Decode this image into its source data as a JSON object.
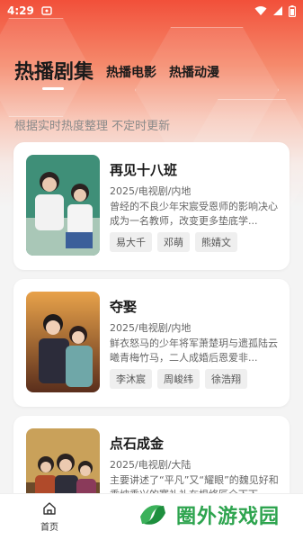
{
  "status_bar": {
    "time": "4:29"
  },
  "tabs": [
    {
      "label": "热播剧集",
      "active": true
    },
    {
      "label": "热播电影",
      "active": false
    },
    {
      "label": "热播动漫",
      "active": false
    }
  ],
  "subtitle": "根据实时热度整理 不定时更新",
  "cards": [
    {
      "title": "再见十八班",
      "meta": "2025/电视剧/内地",
      "desc": "曾经的不良少年宋宸受恩师的影响决心成为一名教师，改变更多垫底学...",
      "tags": [
        "易大千",
        "邓萌",
        "熊婧文"
      ]
    },
    {
      "title": "夺娶",
      "meta": "2025/电视剧/内地",
      "desc": "鲜衣怒马的少年将军萧楚玥与遗孤陆云曦青梅竹马，二人成婚后恩爱非...",
      "tags": [
        "李沐宸",
        "周峻纬",
        "徐浩翔"
      ]
    },
    {
      "title": "点石成金",
      "meta": "2025/电视剧/大陆",
      "desc": "主要讲述了“平凡”又“耀眼”的魏见好和乘坡乘兴的寒礼礼在根络匠全下下...",
      "tags": []
    }
  ],
  "bottom_nav": {
    "home_label": "首页"
  },
  "watermark": {
    "text": "圈外游戏园"
  },
  "colors": {
    "accent": "#f2503a",
    "watermark": "#2ea44f"
  }
}
